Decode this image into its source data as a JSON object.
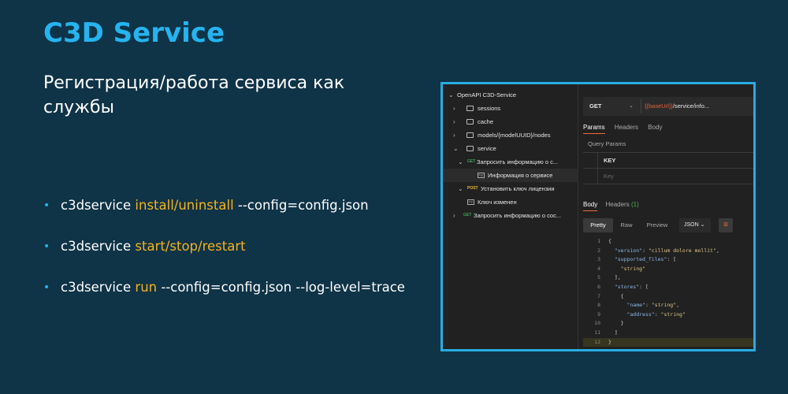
{
  "slide": {
    "title": "C3D Service",
    "subtitle": "Регистрация/работа сервиса как службы",
    "bullets": [
      {
        "pre": "c3dservice ",
        "hl": "install/uninstall",
        "post": " --config=config.json"
      },
      {
        "pre": "c3dservice ",
        "hl": "start/stop/restart",
        "post": ""
      },
      {
        "pre": " c3dservice ",
        "hl": "run",
        "post": " --config=config.json --log-level=trace"
      }
    ],
    "bullet_color": "#25b4ef",
    "highlight_color": "#f5b31e"
  },
  "screenshot": {
    "tree": {
      "collection": "OpenAPI C3D-Service",
      "items": [
        {
          "label": "sessions"
        },
        {
          "label": "cache"
        },
        {
          "label": "models/{modelUUID}/nodes"
        },
        {
          "label": "service"
        },
        {
          "method": "GET",
          "label": "Запросить информацию о с..."
        },
        {
          "label": "Информация о сервисе",
          "icon": "e.g."
        },
        {
          "method": "POST",
          "label": "Установить ключ лицензии"
        },
        {
          "label": "Ключ изменен",
          "icon": "e.g."
        },
        {
          "method": "GET",
          "label": "Запросить информацию о сос..."
        }
      ]
    },
    "request": {
      "method": "GET",
      "url_var": "{{baseUrl}}",
      "url_rest": "/service/info...",
      "tabs": [
        "Params",
        "Headers",
        "Body"
      ],
      "query_params_title": "Query Params",
      "key_header": "KEY",
      "key_placeholder": "Key"
    },
    "response": {
      "tab_body": "Body",
      "tab_headers": "Headers",
      "headers_count": "(1)",
      "formats": [
        "Pretty",
        "Raw",
        "Preview"
      ],
      "format_select": "JSON",
      "code_lines": [
        "{",
        "  \"version\": \"cillum dolore mollit\",",
        "  \"supported_files\": [",
        "    \"string\"",
        "  ],",
        "  \"stores\": [",
        "    {",
        "      \"name\": \"string\",",
        "      \"address\": \"string\"",
        "    }",
        "  ]",
        "}"
      ]
    }
  }
}
